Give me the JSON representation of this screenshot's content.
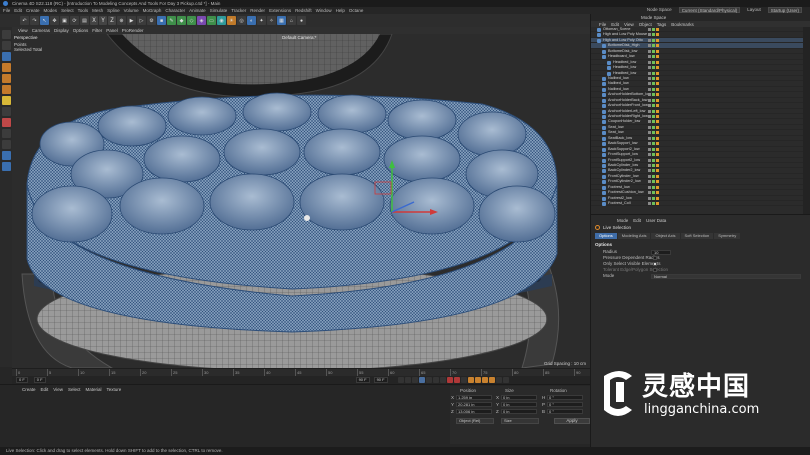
{
  "window": {
    "title": "Cinema 4D S22.118 (RC) - [Introduction To Modeling Concepts And Tools For Day 3 Pickup.c4d *] - Main"
  },
  "menubar": {
    "items": [
      "File",
      "Edit",
      "Create",
      "Modes",
      "Select",
      "Tools",
      "Mesh",
      "Spline",
      "Volume",
      "MoGraph",
      "Character",
      "Animate",
      "Simulate",
      "Tracker",
      "Render",
      "Extensions",
      "Redshift",
      "Window",
      "Help",
      "Octane"
    ],
    "node_space_label": "Node Space",
    "node_space_value": "Current (Standard/Physical)",
    "layout_label": "Layout",
    "layout_value": "Startup (User)"
  },
  "toolbar": {
    "axis_x": "X",
    "axis_y": "Y",
    "axis_z": "Z"
  },
  "viewport": {
    "menu": [
      "View",
      "Cameras",
      "Display",
      "Options",
      "Filter",
      "Panel",
      "ProRender"
    ],
    "view_name": "Perspective",
    "hud_points_label": "Points",
    "hud_selected_total": "Selected Total",
    "camera_name": "Default Camera:*",
    "grid_spacing": "Grid Spacing : 10 cm"
  },
  "timeline": {
    "ticks": [
      "0",
      "5",
      "10",
      "15",
      "20",
      "25",
      "30",
      "35",
      "40",
      "45",
      "50",
      "55",
      "60",
      "65",
      "70",
      "75",
      "80",
      "85",
      "90"
    ],
    "current_frame": "0 F",
    "start_frame": "0 F",
    "end_frame": "90 F",
    "end_frame_2": "90 F"
  },
  "material_manager": {
    "menu": [
      "Create",
      "Edit",
      "View",
      "Select",
      "Material",
      "Texture"
    ]
  },
  "coordinates": {
    "headers": [
      "Position",
      "Size",
      "Rotation"
    ],
    "rows": [
      {
        "pos_axis": "X",
        "pos": "1.259 in",
        "size_axis": "X",
        "size": "0 in",
        "rot_axis": "H",
        "rot": "0 °"
      },
      {
        "pos_axis": "Y",
        "pos": "20.281 in",
        "size_axis": "Y",
        "size": "0 in",
        "rot_axis": "P",
        "rot": "0 °"
      },
      {
        "pos_axis": "Z",
        "pos": "13.006 in",
        "size_axis": "Z",
        "size": "0 in",
        "rot_axis": "B",
        "rot": "0 °"
      }
    ],
    "mode_object": "Object (Rel)",
    "mode_size": "Size",
    "apply_label": "Apply"
  },
  "object_manager": {
    "top_mode": "Mode Space",
    "menu": [
      "File",
      "Edit",
      "View",
      "Object",
      "Tags",
      "Bookmarks"
    ],
    "objects": [
      {
        "name": "Ottoman_Scene",
        "indent": 0,
        "selected": false
      },
      {
        "name": "High and Low Poly Mouse",
        "indent": 0,
        "selected": false
      },
      {
        "name": "High and Low Poly Otto",
        "indent": 0,
        "selected": true
      },
      {
        "name": "BottomeDisk_High",
        "indent": 1,
        "selected": true
      },
      {
        "name": "BottomeDisk_low",
        "indent": 1,
        "selected": false
      },
      {
        "name": "Headboard_low",
        "indent": 1,
        "selected": false
      },
      {
        "name": "Headbed_low",
        "indent": 2,
        "selected": false
      },
      {
        "name": "Headbed_low",
        "indent": 2,
        "selected": false
      },
      {
        "name": "Headbed_low",
        "indent": 2,
        "selected": false
      },
      {
        "name": "Nailbed_low",
        "indent": 1,
        "selected": false
      },
      {
        "name": "Nailbed_low",
        "indent": 1,
        "selected": false
      },
      {
        "name": "Nailbed_low",
        "indent": 1,
        "selected": false
      },
      {
        "name": "AnchorHolderBottom_low",
        "indent": 1,
        "selected": false
      },
      {
        "name": "AnchorHolderBack_low",
        "indent": 1,
        "selected": false
      },
      {
        "name": "AnchorHolderFront_low",
        "indent": 1,
        "selected": false
      },
      {
        "name": "AnchorHolderLeft_low",
        "indent": 1,
        "selected": false
      },
      {
        "name": "AnchorHolderRight_low",
        "indent": 1,
        "selected": false
      },
      {
        "name": "CouponHolder_low",
        "indent": 1,
        "selected": false
      },
      {
        "name": "Seat_low",
        "indent": 1,
        "selected": false
      },
      {
        "name": "Seat_low",
        "indent": 1,
        "selected": false
      },
      {
        "name": "SeatBack_low",
        "indent": 1,
        "selected": false
      },
      {
        "name": "BackSupport_low",
        "indent": 1,
        "selected": false
      },
      {
        "name": "BackSupport2_low",
        "indent": 1,
        "selected": false
      },
      {
        "name": "FrontSupport_low",
        "indent": 1,
        "selected": false
      },
      {
        "name": "FrontSupport2_low",
        "indent": 1,
        "selected": false
      },
      {
        "name": "BackCylinder_low",
        "indent": 1,
        "selected": false
      },
      {
        "name": "BackCylinder2_low",
        "indent": 1,
        "selected": false
      },
      {
        "name": "FrontCylinder_low",
        "indent": 1,
        "selected": false
      },
      {
        "name": "FrontCylinder2_low",
        "indent": 1,
        "selected": false
      },
      {
        "name": "Footrest_low",
        "indent": 1,
        "selected": false
      },
      {
        "name": "FootrestCushion_low",
        "indent": 1,
        "selected": false
      },
      {
        "name": "Footrest2_low",
        "indent": 1,
        "selected": false
      },
      {
        "name": "Footrest_Coll",
        "indent": 1,
        "selected": false
      }
    ]
  },
  "attribute_manager": {
    "menu": [
      "Mode",
      "Edit",
      "User Data"
    ],
    "tool_name": "Live Selection",
    "tabs": [
      "Options",
      "Modeling Axis",
      "Object Axis",
      "Soft Selection",
      "Symmetry"
    ],
    "section": "Options",
    "radius_label": "Radius",
    "radius_value": "10",
    "pressure_label": "Pressure Dependent Radius",
    "only_visible_label": "Only Select Visible Elements",
    "only_visible_checked": true,
    "edge_tolerance_label": "Tolerant Edge/Polygon Selection",
    "mode_label": "Mode",
    "mode_value": "Normal"
  },
  "statusbar": {
    "text": "Live Selection: Click and drag to select elements. Hold down SHIFT to add to the selection, CTRL to remove."
  },
  "watermark": {
    "chinese": "灵感中国",
    "url": "lingganchina.com"
  },
  "colors": {
    "accent_blue": "#3f6da8",
    "mesh_blue": "#2e5d9a",
    "selection_orange": "#e08a2a"
  }
}
